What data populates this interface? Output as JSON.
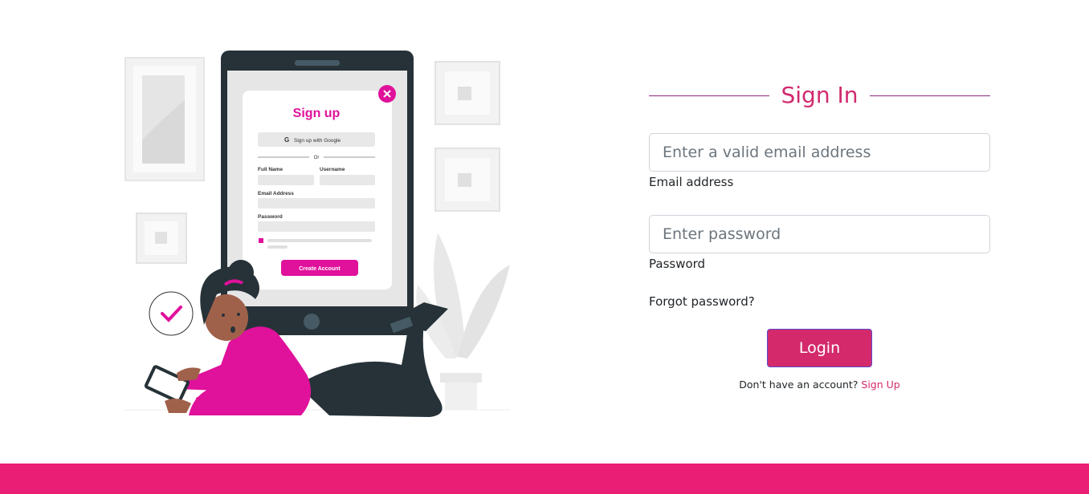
{
  "illustration": {
    "card_title": "Sign up",
    "google_label": "Sign up with Google",
    "divider_text": "Or",
    "full_name_label": "Full Name",
    "username_label": "Username",
    "email_label": "Email Address",
    "password_label": "Password",
    "create_label": "Create Account"
  },
  "signin": {
    "heading": "Sign In",
    "email": {
      "placeholder": "Enter a valid email address",
      "label": "Email address"
    },
    "password": {
      "placeholder": "Enter password",
      "label": "Password"
    },
    "forgot": "Forgot password?",
    "login_label": "Login",
    "no_account_text": "Don't have an account? ",
    "signup_label": "Sign Up"
  },
  "colors": {
    "accent": "#d42a6c",
    "footer": "#e91e74",
    "illustration_pink": "#e0119b",
    "heading_line": "#8e2a7c"
  }
}
